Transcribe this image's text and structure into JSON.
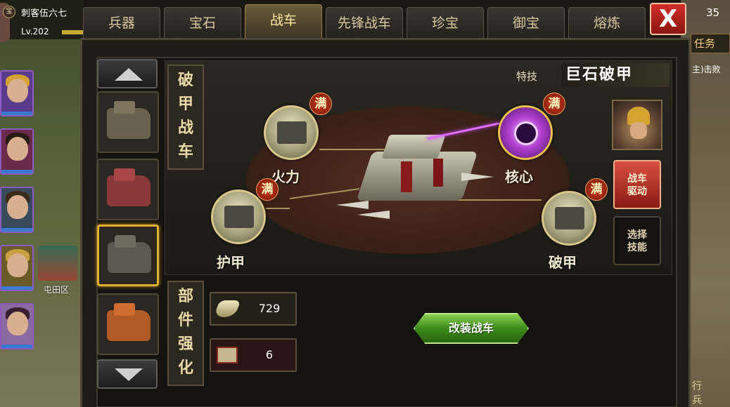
{
  "player": {
    "badge": "宝",
    "name": "刺客伍六七",
    "level": "Lv.202"
  },
  "background": {
    "fortress_label": "屯田区",
    "right_value": "35",
    "right_tab": "任务",
    "right_task": "主)击败",
    "right_bottom": "行 兵"
  },
  "tabs": [
    {
      "label": "兵器"
    },
    {
      "label": "宝石"
    },
    {
      "label": "战车"
    },
    {
      "label": "先锋战车"
    },
    {
      "label": "珍宝"
    },
    {
      "label": "御宝"
    },
    {
      "label": "熔炼"
    }
  ],
  "active_tab": "战车",
  "close_label": "X",
  "chariot_title": [
    "破",
    "甲",
    "战",
    "车"
  ],
  "component_title": [
    "部",
    "件",
    "强",
    "化"
  ],
  "skill": {
    "label": "特技",
    "name": "巨石破甲"
  },
  "nodes": {
    "firepower": {
      "label": "火力",
      "badge": "满"
    },
    "core": {
      "label": "核心",
      "badge": "满"
    },
    "armor": {
      "label": "护甲",
      "badge": "满"
    },
    "pierce": {
      "label": "破甲",
      "badge": "满"
    }
  },
  "side_buttons": {
    "drive": [
      "战车",
      "驱动"
    ],
    "choose_skill": [
      "选择",
      "技能"
    ]
  },
  "resources": {
    "silver": "729",
    "scroll": "6"
  },
  "upgrade_button": "改装战车",
  "colors": {
    "accent_gold": "#e0b030",
    "close_red": "#d22e28",
    "upgrade_green": "#3e8a1c",
    "core_purple": "#b040d0"
  }
}
